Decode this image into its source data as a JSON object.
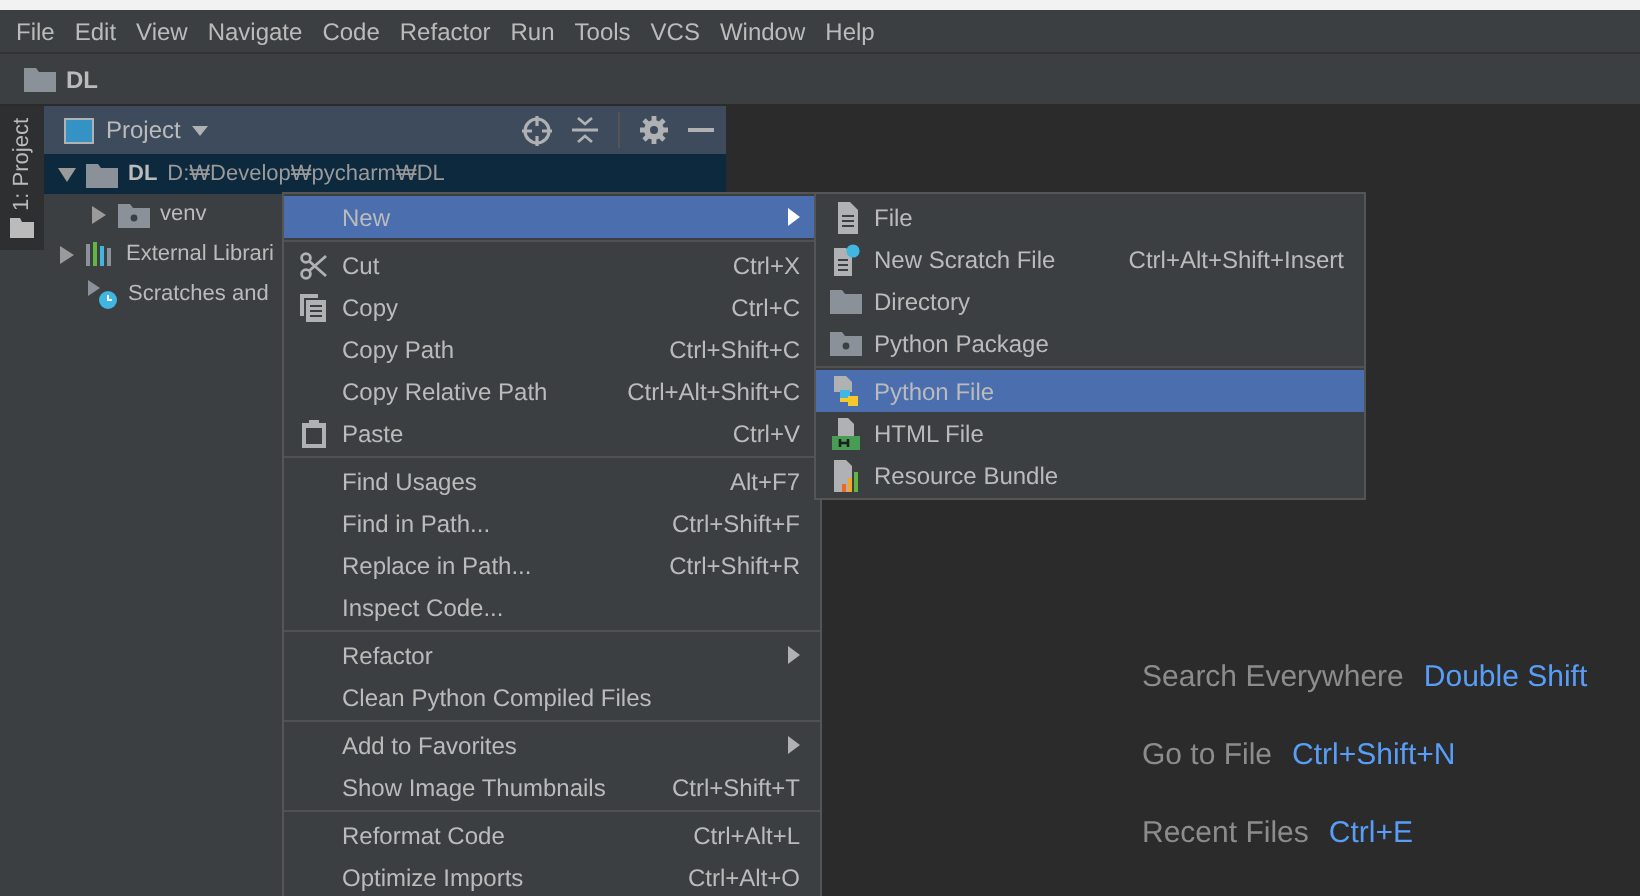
{
  "menu_bar": [
    "File",
    "Edit",
    "View",
    "Navigate",
    "Code",
    "Refactor",
    "Run",
    "Tools",
    "VCS",
    "Window",
    "Help"
  ],
  "breadcrumb": "DL",
  "tool_stripe": {
    "label": "1: Project",
    "selected": true
  },
  "project_panel": {
    "title": "Project",
    "tree": [
      {
        "kind": "folder",
        "label": "DL",
        "path": "D:₩Develop₩pycharm₩DL",
        "expanded": true,
        "selected": true,
        "children": [
          {
            "kind": "venv",
            "label": "venv",
            "expanded": false,
            "selected": false
          }
        ]
      },
      {
        "kind": "libraries",
        "label": "External Librari",
        "expanded": false,
        "selected": false
      },
      {
        "kind": "scratches",
        "label": "Scratches and",
        "selected": false
      }
    ]
  },
  "context_menu": {
    "groups": [
      [
        {
          "label": "New",
          "submenu": true,
          "selected": true
        }
      ],
      [
        {
          "label": "Cut",
          "shortcut": "Ctrl+X",
          "kind": "scissors",
          "selected": false
        },
        {
          "label": "Copy",
          "shortcut": "Ctrl+C",
          "kind": "copy",
          "selected": false
        },
        {
          "label": "Copy Path",
          "shortcut": "Ctrl+Shift+C",
          "selected": false
        },
        {
          "label": "Copy Relative Path",
          "shortcut": "Ctrl+Alt+Shift+C",
          "selected": false
        },
        {
          "label": "Paste",
          "shortcut": "Ctrl+V",
          "kind": "clipboard",
          "selected": false
        }
      ],
      [
        {
          "label": "Find Usages",
          "shortcut": "Alt+F7",
          "selected": false
        },
        {
          "label": "Find in Path...",
          "shortcut": "Ctrl+Shift+F",
          "selected": false
        },
        {
          "label": "Replace in Path...",
          "shortcut": "Ctrl+Shift+R",
          "selected": false
        },
        {
          "label": "Inspect Code...",
          "selected": false
        }
      ],
      [
        {
          "label": "Refactor",
          "submenu": true,
          "selected": false
        },
        {
          "label": "Clean Python Compiled Files",
          "selected": false
        }
      ],
      [
        {
          "label": "Add to Favorites",
          "submenu": true,
          "selected": false
        },
        {
          "label": "Show Image Thumbnails",
          "shortcut": "Ctrl+Shift+T",
          "selected": false
        }
      ],
      [
        {
          "label": "Reformat Code",
          "shortcut": "Ctrl+Alt+L",
          "selected": false
        },
        {
          "label": "Optimize Imports",
          "shortcut": "Ctrl+Alt+O",
          "selected": false
        }
      ]
    ]
  },
  "new_submenu": {
    "groups": [
      [
        {
          "label": "File",
          "kind": "file",
          "selected": false
        },
        {
          "label": "New Scratch File",
          "shortcut": "Ctrl+Alt+Shift+Insert",
          "kind": "scratch",
          "selected": false
        },
        {
          "label": "Directory",
          "kind": "folder",
          "selected": false
        },
        {
          "label": "Python Package",
          "kind": "package",
          "selected": false
        }
      ],
      [
        {
          "label": "Python File",
          "kind": "python",
          "selected": true
        },
        {
          "label": "HTML File",
          "kind": "html",
          "selected": false
        },
        {
          "label": "Resource Bundle",
          "kind": "bundle",
          "selected": false
        }
      ]
    ]
  },
  "editor_hints": [
    {
      "label": "Search Everywhere",
      "shortcut": "Double Shift"
    },
    {
      "label": "Go to File",
      "shortcut": "Ctrl+Shift+N"
    },
    {
      "label": "Recent Files",
      "shortcut": "Ctrl+E"
    }
  ]
}
